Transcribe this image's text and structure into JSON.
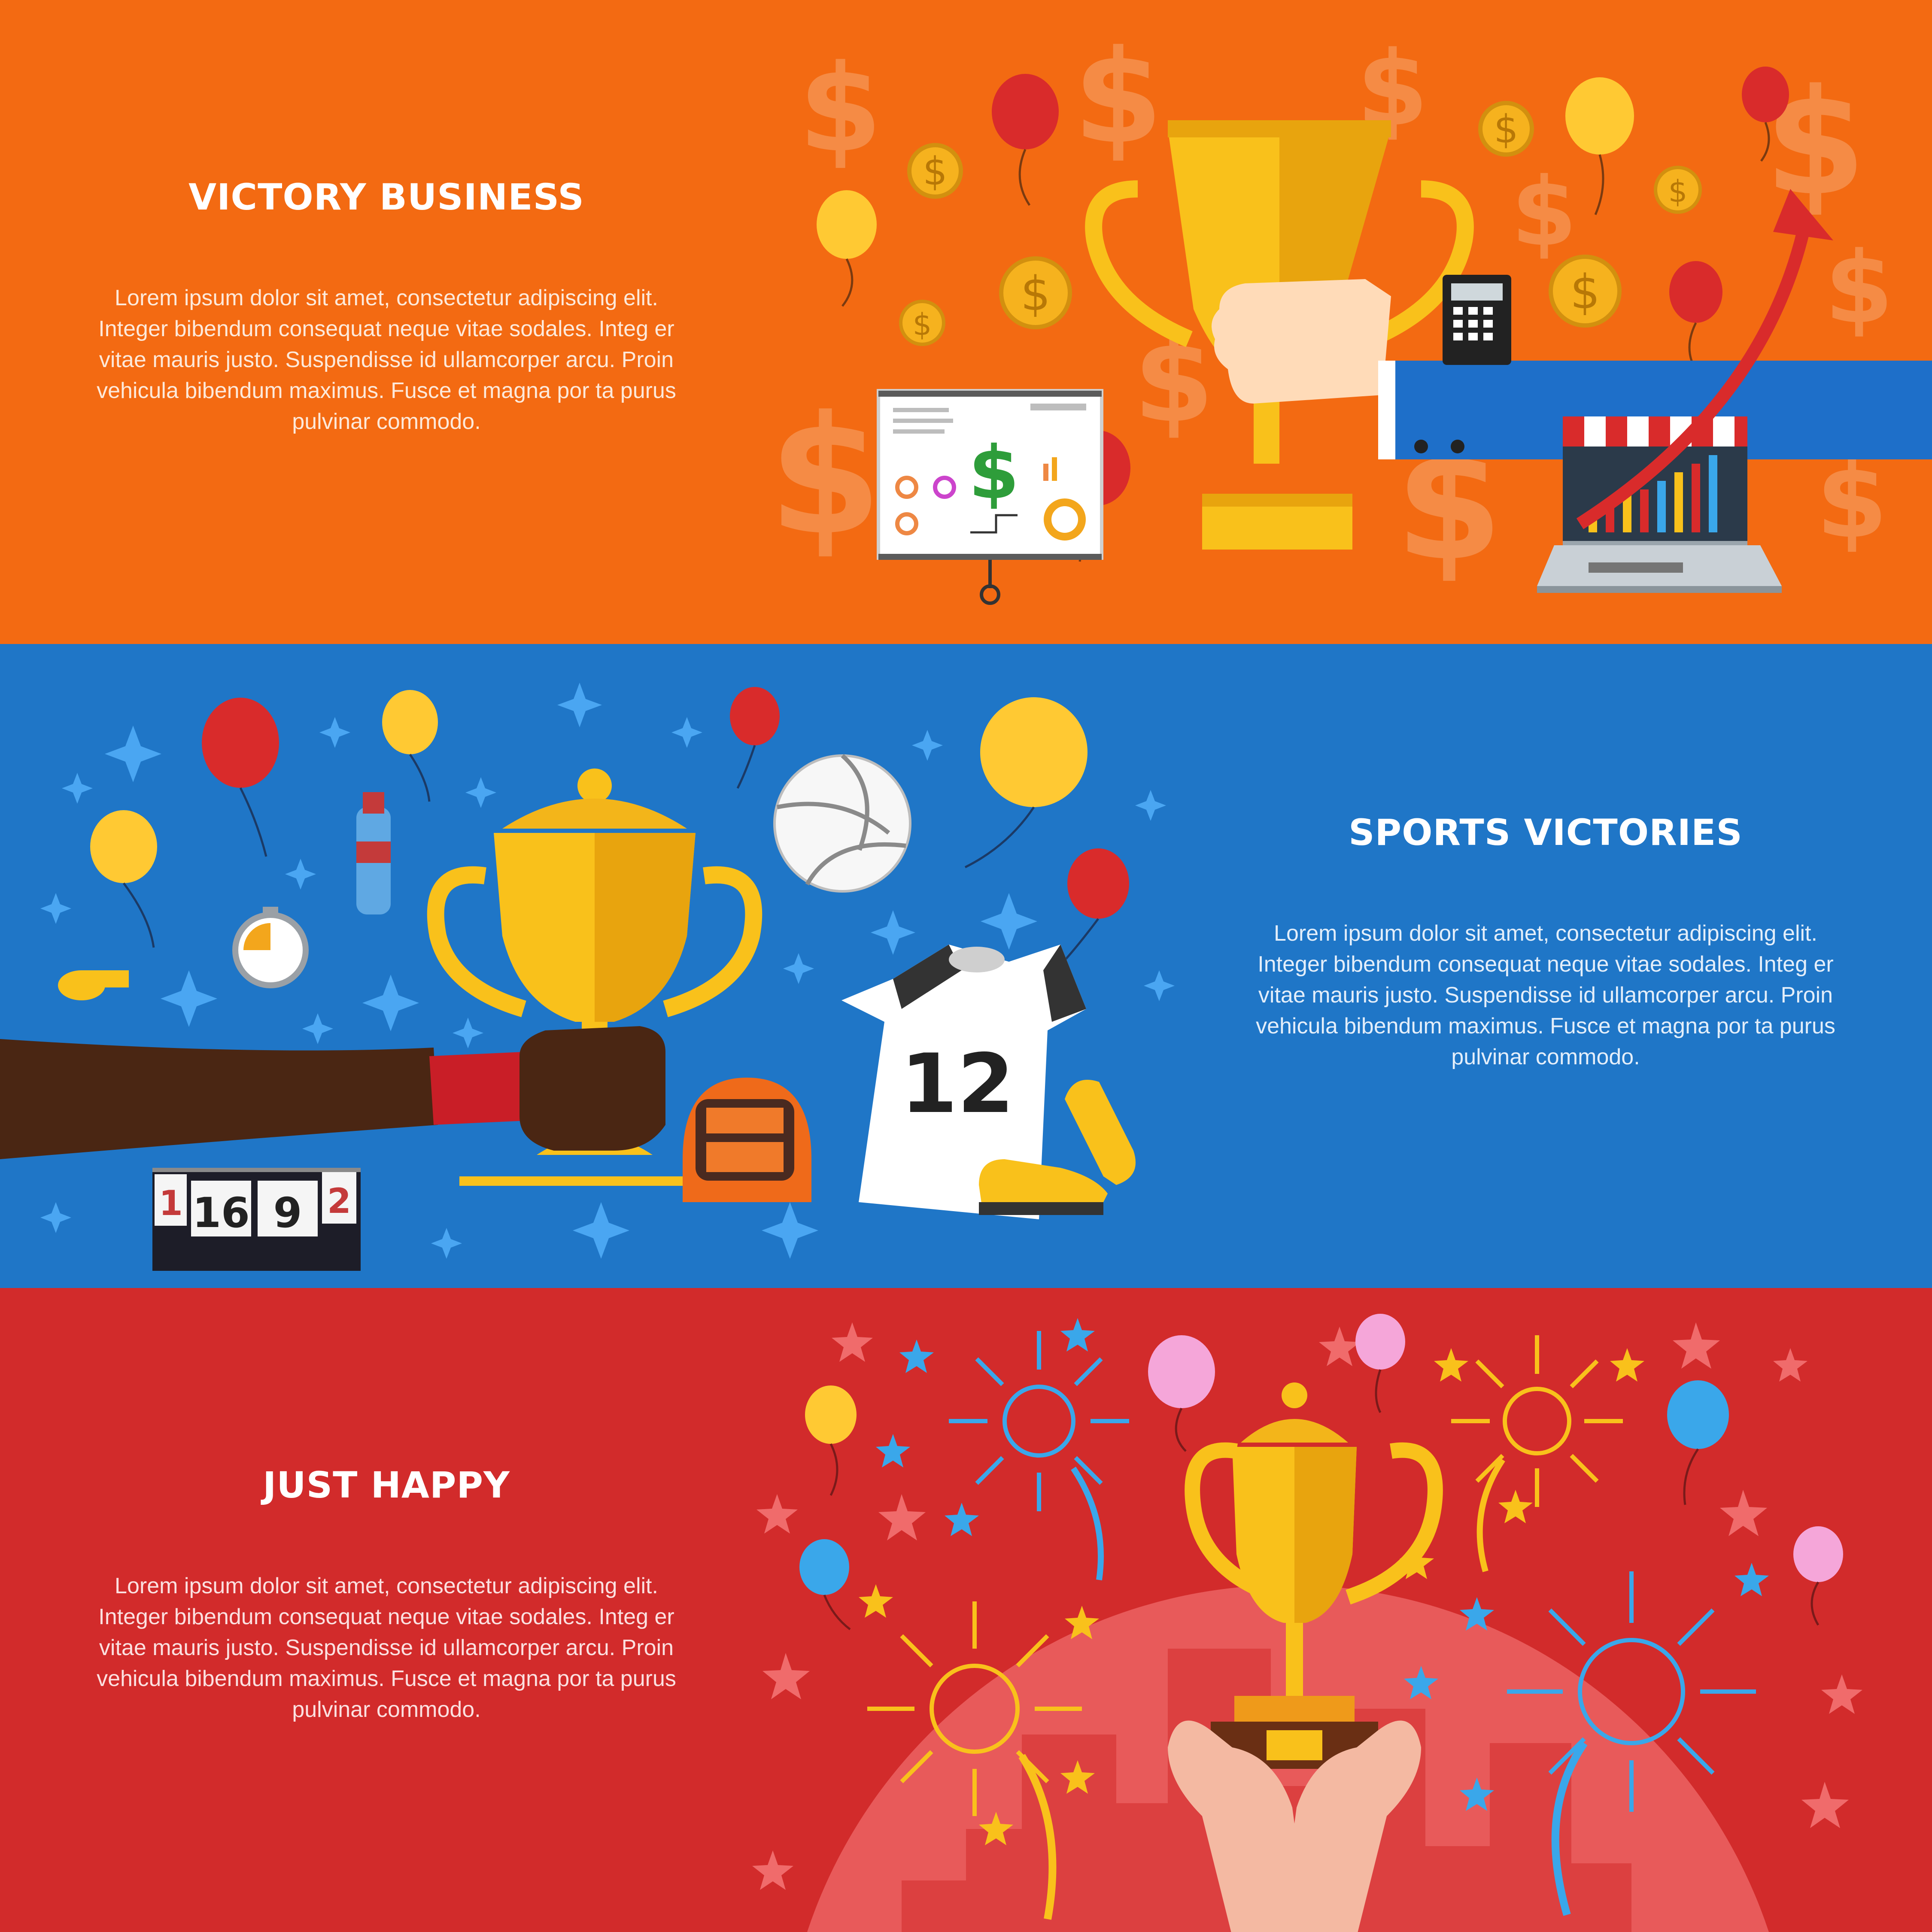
{
  "banners": [
    {
      "title": "VICTORY BUSINESS",
      "body": "Lorem ipsum dolor sit amet, consectetur adipiscing elit. Integer bibendum consequat neque vitae sodales. Integ er vitae mauris justo. Suspendisse id ullamcorper arcu. Proin vehicula bibendum maximus. Fusce et magna por ta purus pulvinar commodo.",
      "bg": "#f36a12",
      "illustration": {
        "icons": [
          "trophy-icon",
          "hand-icon",
          "dollar-sign-icon",
          "gold-coin-icon",
          "balloon-icon",
          "presentation-board-icon",
          "calculator-icon",
          "laptop-shop-icon",
          "growth-arrow-icon"
        ]
      }
    },
    {
      "title": "SPORTS VICTORIES",
      "body": "Lorem ipsum dolor sit amet, consectetur adipiscing elit. Integer bibendum consequat neque vitae sodales. Integ er vitae mauris justo. Suspendisse id ullamcorper arcu. Proin vehicula bibendum maximus. Fusce et magna por ta purus pulvinar commodo.",
      "bg": "#1f76c7",
      "illustration": {
        "jersey_number": "12",
        "scoreboard": [
          "1",
          "16",
          "9",
          "2"
        ],
        "icons": [
          "trophy-icon",
          "hand-icon",
          "volleyball-icon",
          "jersey-icon",
          "boot-icon",
          "helmet-icon",
          "stopwatch-icon",
          "whistle-icon",
          "water-bottle-icon",
          "balloon-icon",
          "sparkle-icon",
          "scoreboard-icon"
        ]
      }
    },
    {
      "title": "JUST HAPPY",
      "body": "Lorem ipsum dolor sit amet, consectetur adipiscing elit. Integer bibendum consequat neque vitae sodales. Integ er vitae mauris justo. Suspendisse id ullamcorper arcu. Proin vehicula bibendum maximus. Fusce et magna por ta purus pulvinar commodo.",
      "bg": "#d22b2b",
      "illustration": {
        "icons": [
          "trophy-icon",
          "hands-icon",
          "firework-icon",
          "star-icon",
          "balloon-icon",
          "city-skyline-icon"
        ]
      }
    }
  ],
  "colors": {
    "gold": "#f9c11b",
    "gold_dark": "#e8a40e",
    "balloon_red": "#d92b2b",
    "balloon_yellow": "#ffc933",
    "balloon_pink": "#f5a6d9",
    "balloon_blue": "#3aa7ea",
    "suit_blue": "#1e6fc9"
  }
}
